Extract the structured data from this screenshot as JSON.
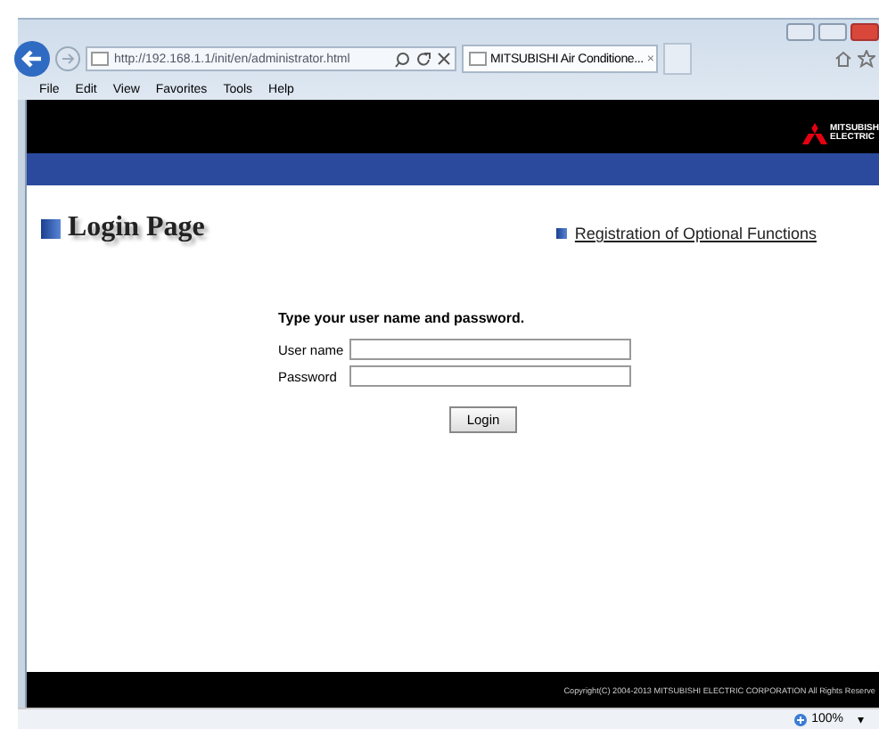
{
  "browser": {
    "address": "http://192.168.1.1/init/en/administrator.html",
    "tab_title": "MITSUBISHI Air Conditione...",
    "tab_close": "×",
    "menu": [
      "File",
      "Edit",
      "View",
      "Favorites",
      "Tools",
      "Help"
    ]
  },
  "header": {
    "logo_lines": [
      "MITSUBISH",
      "ELECTRIC"
    ]
  },
  "page": {
    "title": "Login Page",
    "link": "Registration of Optional Functions",
    "instruction": "Type your user name and password.",
    "fields": [
      {
        "label": "User name"
      },
      {
        "label": "Password"
      }
    ],
    "button": "Login"
  },
  "footer": {
    "copyright": "Copyright(C) 2004-2013 MITSUBISHI ELECTRIC CORPORATION All Rights Reserve"
  },
  "status_bar": {
    "zoom": "100%",
    "caret": "▾"
  }
}
